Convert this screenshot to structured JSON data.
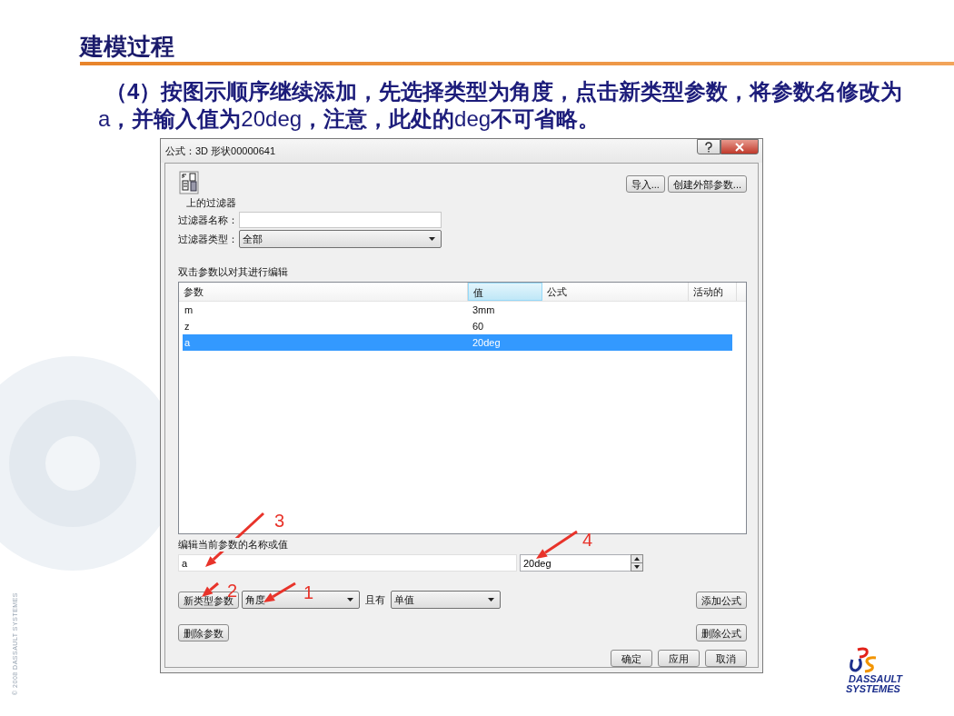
{
  "slide": {
    "title": "建模过程",
    "instruction": "**（4）按图示顺序继续添加，先选择类型为角度，点击新类型参数，将参数名修改为**a**，并输入值为**20deg**，注意，此处的**deg**不可省略。**",
    "copyright": "© 2008 DASSAULT SYSTEMES",
    "logo_lines": [
      "DASSAULT",
      "SYSTEMES"
    ]
  },
  "dialog": {
    "title": "公式：3D 形状00000641",
    "top_buttons": [
      "导入...",
      "创建外部参数..."
    ],
    "filter_heading": "上的过滤器",
    "filter_name_label": "过滤器名称：",
    "filter_type_label": "过滤器类型：",
    "filter_type_value": "全部",
    "table_hint": "双击参数以对其进行编辑",
    "columns": [
      {
        "label": "参数",
        "sorted": false
      },
      {
        "label": "值",
        "sorted": true
      },
      {
        "label": "公式",
        "sorted": false
      },
      {
        "label": "活动的",
        "sorted": false
      }
    ],
    "rows": [
      {
        "cells": [
          "m",
          "3mm"
        ],
        "selected": false
      },
      {
        "cells": [
          "z",
          "60"
        ],
        "selected": false
      },
      {
        "cells": [
          "a",
          "20deg"
        ],
        "selected": true
      }
    ],
    "edit_label": "编辑当前参数的名称或值",
    "name_value": "a",
    "param_value": "20deg",
    "new_param_button": "新类型参数",
    "type_value": "角度",
    "with_label": "且有",
    "multiplicity_value": "单值",
    "add_formula_button": "添加公式",
    "delete_param_button": "删除参数",
    "delete_formula_button": "删除公式",
    "footer_buttons": [
      "确定",
      "应用",
      "取消"
    ]
  },
  "annotations": [
    {
      "label": "3"
    },
    {
      "label": "2"
    },
    {
      "label": "1"
    },
    {
      "label": "4"
    }
  ]
}
